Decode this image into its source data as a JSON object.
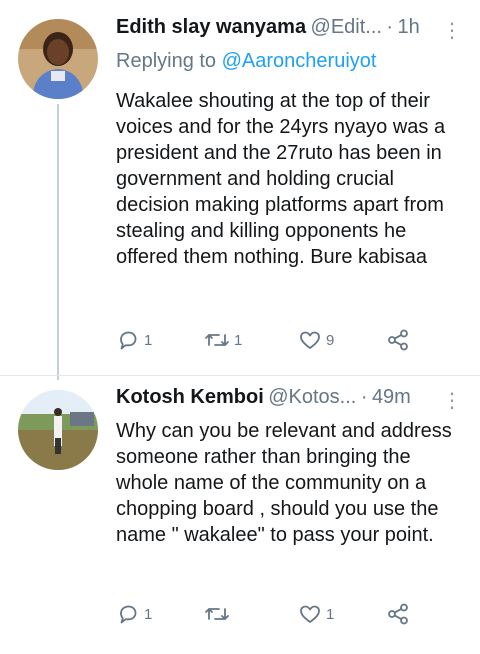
{
  "tweets": [
    {
      "name": "Edith slay wanyama",
      "handle": "@Edit...",
      "sep": "·",
      "time": "1h",
      "more": "⋮",
      "replying_prefix": "Replying to",
      "replying_to": "@Aaroncheruiyot",
      "text": "Wakalee shouting at the top of their voices and for the 24yrs nyayo was a president and the 27ruto has been in government and holding crucial decision making platforms apart from stealing and killing opponents he offered them nothing. Bure kabisaa",
      "replies": "1",
      "retweets": "1",
      "likes": "9"
    },
    {
      "name": "Kotosh Kemboi",
      "handle": "@Kotos...",
      "sep": "·",
      "time": "49m",
      "more": "⋮",
      "text": "Why can you be relevant and address someone rather than bringing the whole name of the community on a chopping board , should you use the name \" wakalee\" to pass your point.",
      "replies": "1",
      "retweets": "",
      "likes": "1"
    }
  ],
  "icons": {
    "reply": "reply-icon",
    "retweet": "retweet-icon",
    "like": "heart-icon",
    "share": "share-icon"
  },
  "colors": {
    "link": "#1da1f2",
    "muted": "#657786",
    "thread_line": "#c4cfd6"
  }
}
